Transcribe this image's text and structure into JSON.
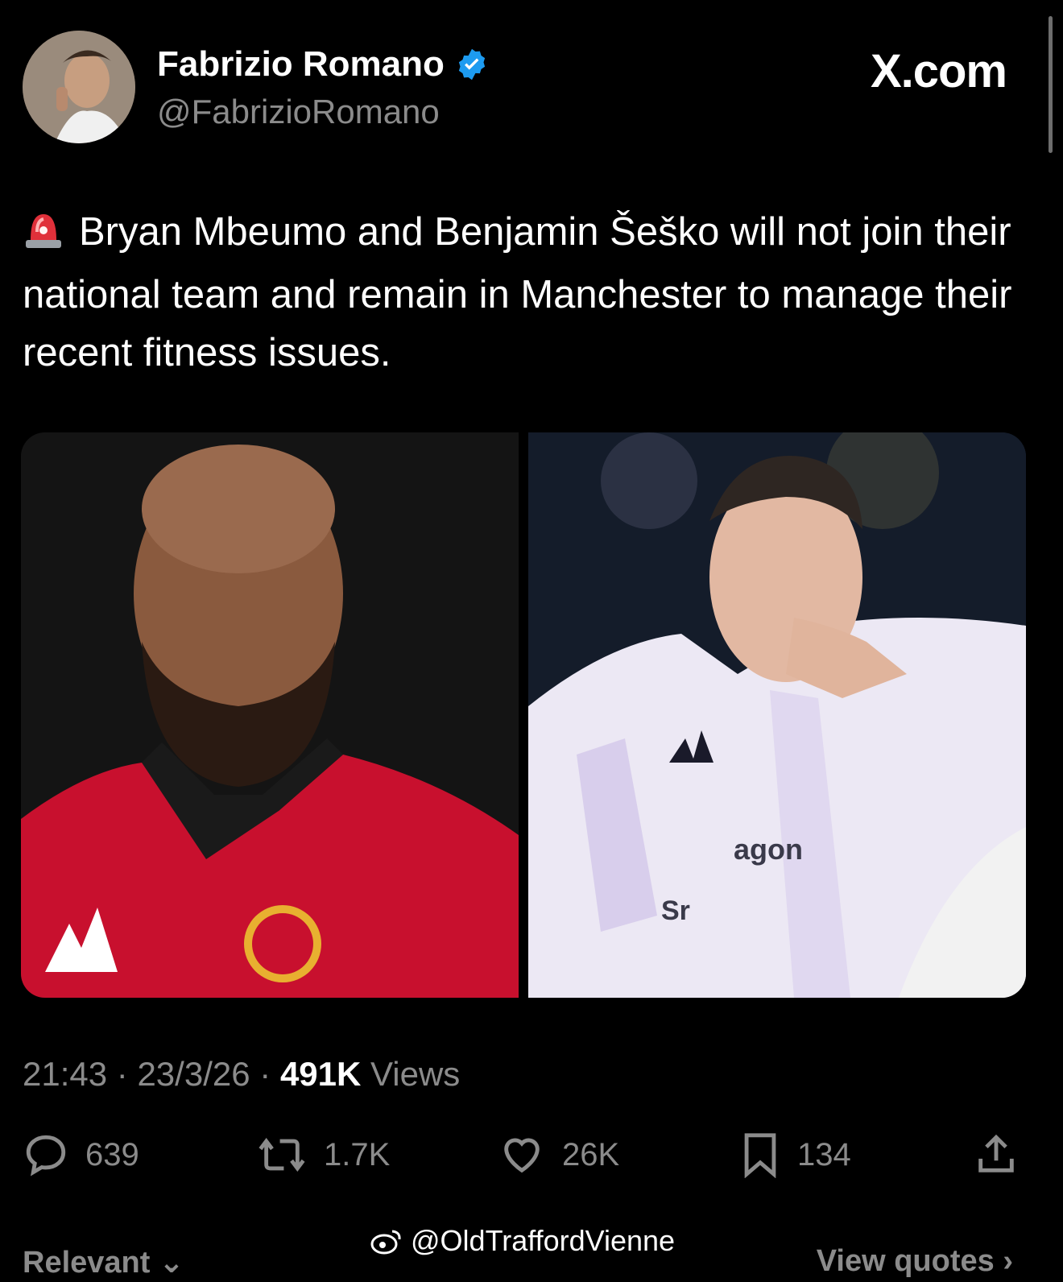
{
  "author": {
    "name": "Fabrizio Romano",
    "handle": "@FabrizioRomano",
    "verified": true
  },
  "brand": "X.com",
  "tweet": {
    "text": "Bryan Mbeumo and Benjamin Šeško will not join their national team and remain in Manchester to manage their recent fitness issues.",
    "emoji": "siren-icon"
  },
  "media": {
    "left": {
      "alt_icon": "player-photo"
    },
    "right": {
      "shirt_text_1": "agon",
      "shirt_text_2": "Sr"
    }
  },
  "meta": {
    "time": "21:43",
    "date": "23/3/26",
    "views_count": "491K",
    "views_label": "Views",
    "separator": "·"
  },
  "actions": {
    "replies": "639",
    "reposts": "1.7K",
    "likes": "26K",
    "bookmarks": "134"
  },
  "watermark": "@OldTraffordVienne",
  "footer": {
    "relevant": "Relevant ⌄",
    "view_quotes": "View quotes ›"
  },
  "colors": {
    "background": "#000000",
    "verified_badge": "#1d9bf0",
    "muted_text": "#8b8b8b",
    "shirt_red": "#c8102e"
  }
}
